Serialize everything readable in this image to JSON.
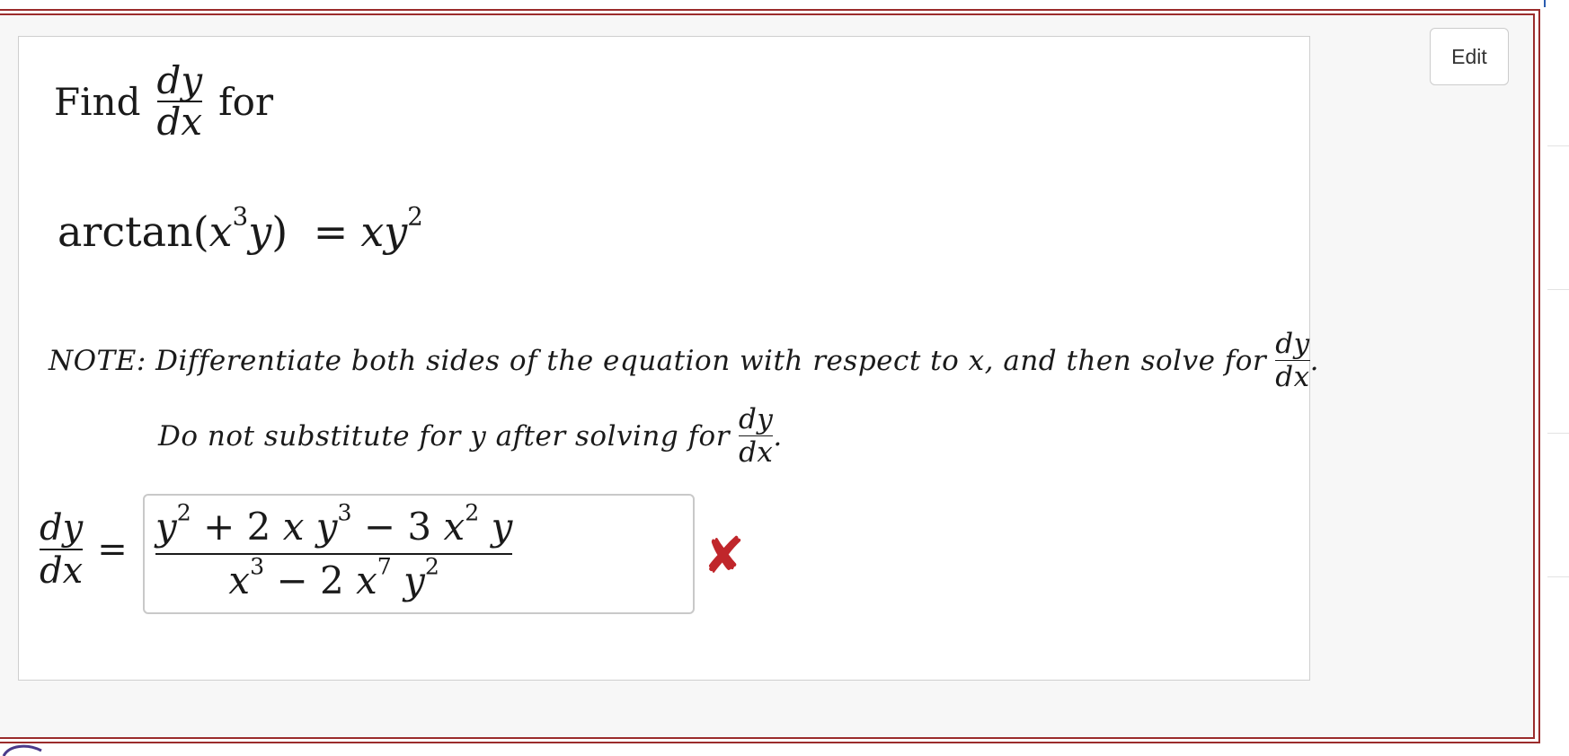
{
  "edit_button": {
    "label": "Edit"
  },
  "question": {
    "find_prefix": "Find",
    "find_suffix": "for",
    "derivative_numerator": "dy",
    "derivative_denominator": "dx",
    "equation": {
      "lhs_func": "arctan(",
      "lhs_x": "x",
      "lhs_x_exp": "3",
      "lhs_y": "y",
      "lhs_close": ")",
      "equals": "=",
      "rhs_xy": "xy",
      "rhs_exp": "2"
    },
    "note": "NOTE: Differentiate both sides of the equation with respect to x, and then solve for",
    "note_end": ".",
    "note_sub": "Do not substitute for y after solving for",
    "note_sub_end": "."
  },
  "answer": {
    "label_numerator": "dy",
    "label_denominator": "dx",
    "equals": "=",
    "numerator": {
      "t1": "y",
      "t1_exp": "2",
      "op1": " + 2 ",
      "t2": "x",
      "t3": " y",
      "t3_exp": "3",
      "op2": " − 3 ",
      "t4": "x",
      "t4_exp": "2",
      "t5": " y"
    },
    "denominator": {
      "t1": "x",
      "t1_exp": "3",
      "op1": " − 2 ",
      "t2": "x",
      "t2_exp": "7",
      "t3": " y",
      "t3_exp": "2"
    },
    "status_icon": "x-mark-icon",
    "status_color": "#c0262b"
  },
  "colors": {
    "frame": "#9b2c2c",
    "panel_border": "#cfcfcf"
  }
}
